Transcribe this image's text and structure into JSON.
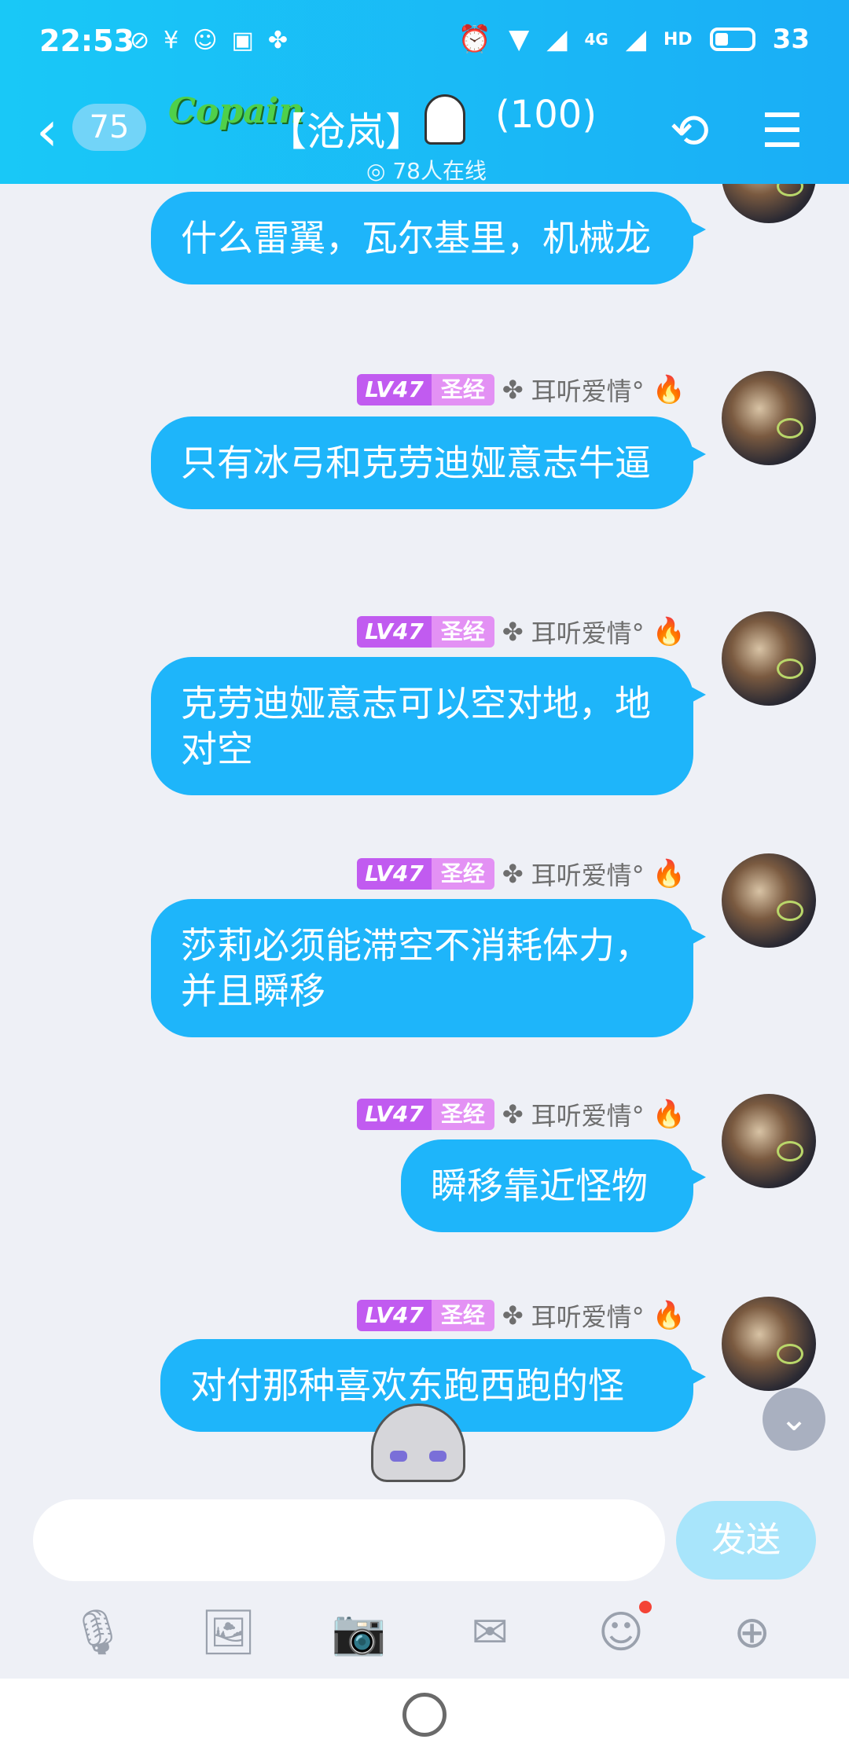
{
  "status_bar": {
    "time": "22:53",
    "network": "4G",
    "hd": "HD",
    "battery": "33"
  },
  "nav": {
    "back_count": "75",
    "logo_text": "Copain",
    "title": "【沧岚】",
    "member_count": "(100)",
    "online": "78人在线"
  },
  "messages": [
    {
      "bubble": "什么雷翼，瓦尔基里，机械龙",
      "show_meta": false
    },
    {
      "level": "LV47",
      "title": "圣经",
      "nick": "耳听爱情°",
      "bubble": "只有冰弓和克劳迪娅意志牛逼"
    },
    {
      "level": "LV47",
      "title": "圣经",
      "nick": "耳听爱情°",
      "bubble": "克劳迪娅意志可以空对地，地对空"
    },
    {
      "level": "LV47",
      "title": "圣经",
      "nick": "耳听爱情°",
      "bubble": "莎莉必须能滞空不消耗体力，并且瞬移"
    },
    {
      "level": "LV47",
      "title": "圣经",
      "nick": "耳听爱情°",
      "bubble": "瞬移靠近怪物"
    },
    {
      "level": "LV47",
      "title": "圣经",
      "nick": "耳听爱情°",
      "bubble": "对付那种喜欢东跑西跑的怪"
    }
  ],
  "input": {
    "text": "",
    "send_label": "发送"
  },
  "toolbar": [
    "microphone-icon",
    "image-icon",
    "camera-icon",
    "red-packet-icon",
    "emoji-icon",
    "plus-icon"
  ]
}
